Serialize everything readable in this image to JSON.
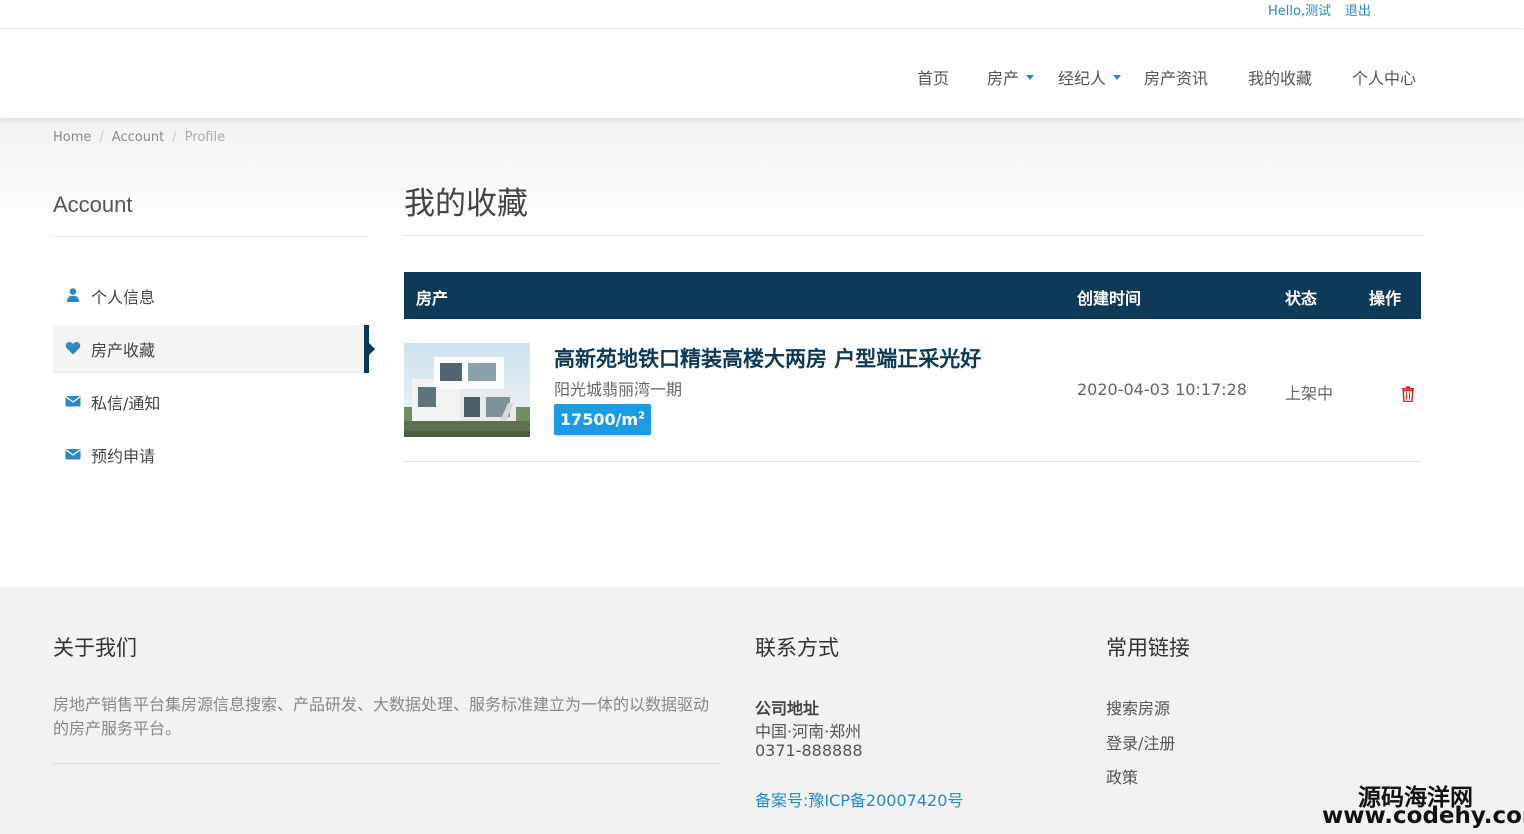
{
  "topbar": {
    "greeting": "Hello,测试",
    "logout": "退出"
  },
  "nav": {
    "home": "首页",
    "property": "房产",
    "agent": "经纪人",
    "news": "房产资讯",
    "favorites": "我的收藏",
    "personal_center": "个人中心"
  },
  "breadcrumb": [
    "Home",
    "Account",
    "Profile"
  ],
  "sidebar": {
    "title": "Account",
    "items": [
      {
        "label": "个人信息",
        "icon": "user-icon"
      },
      {
        "label": "房产收藏",
        "icon": "heart-icon",
        "active": true
      },
      {
        "label": "私信/通知",
        "icon": "envelope-icon"
      },
      {
        "label": "预约申请",
        "icon": "envelope-icon"
      }
    ]
  },
  "main": {
    "title": "我的收藏",
    "columns": {
      "property": "房产",
      "created": "创建时间",
      "status": "状态",
      "action": "操作"
    },
    "rows": [
      {
        "title": "高新苑地铁口精装高楼大两房 户型端正采光好",
        "community": "阳光城翡丽湾一期",
        "price": "17500/m",
        "price_sup": "2",
        "created": "2020-04-03 10:17:28",
        "status": "上架中",
        "action_icon": "trash-icon"
      }
    ]
  },
  "footer": {
    "about": {
      "heading": "关于我们",
      "text": "房地产销售平台集房源信息搜索、产品研发、大数据处理、服务标准建立为一体的以数据驱动的房产服务平台。"
    },
    "contact": {
      "heading": "联系方式",
      "address_label": "公司地址",
      "address": "中国·河南·郑州",
      "phone": "0371-888888",
      "icp": "备案号:豫ICP备20007420号"
    },
    "links": {
      "heading": "常用链接",
      "items": [
        "搜索房源",
        "登录/注册",
        "政策"
      ]
    }
  },
  "watermark": {
    "name": "源码海洋网",
    "url": "www.codehy.com"
  },
  "colors": {
    "navy": "#0c3a58",
    "accent": "#1a9be3",
    "link": "#2a8ac2",
    "danger": "#c9302c"
  }
}
